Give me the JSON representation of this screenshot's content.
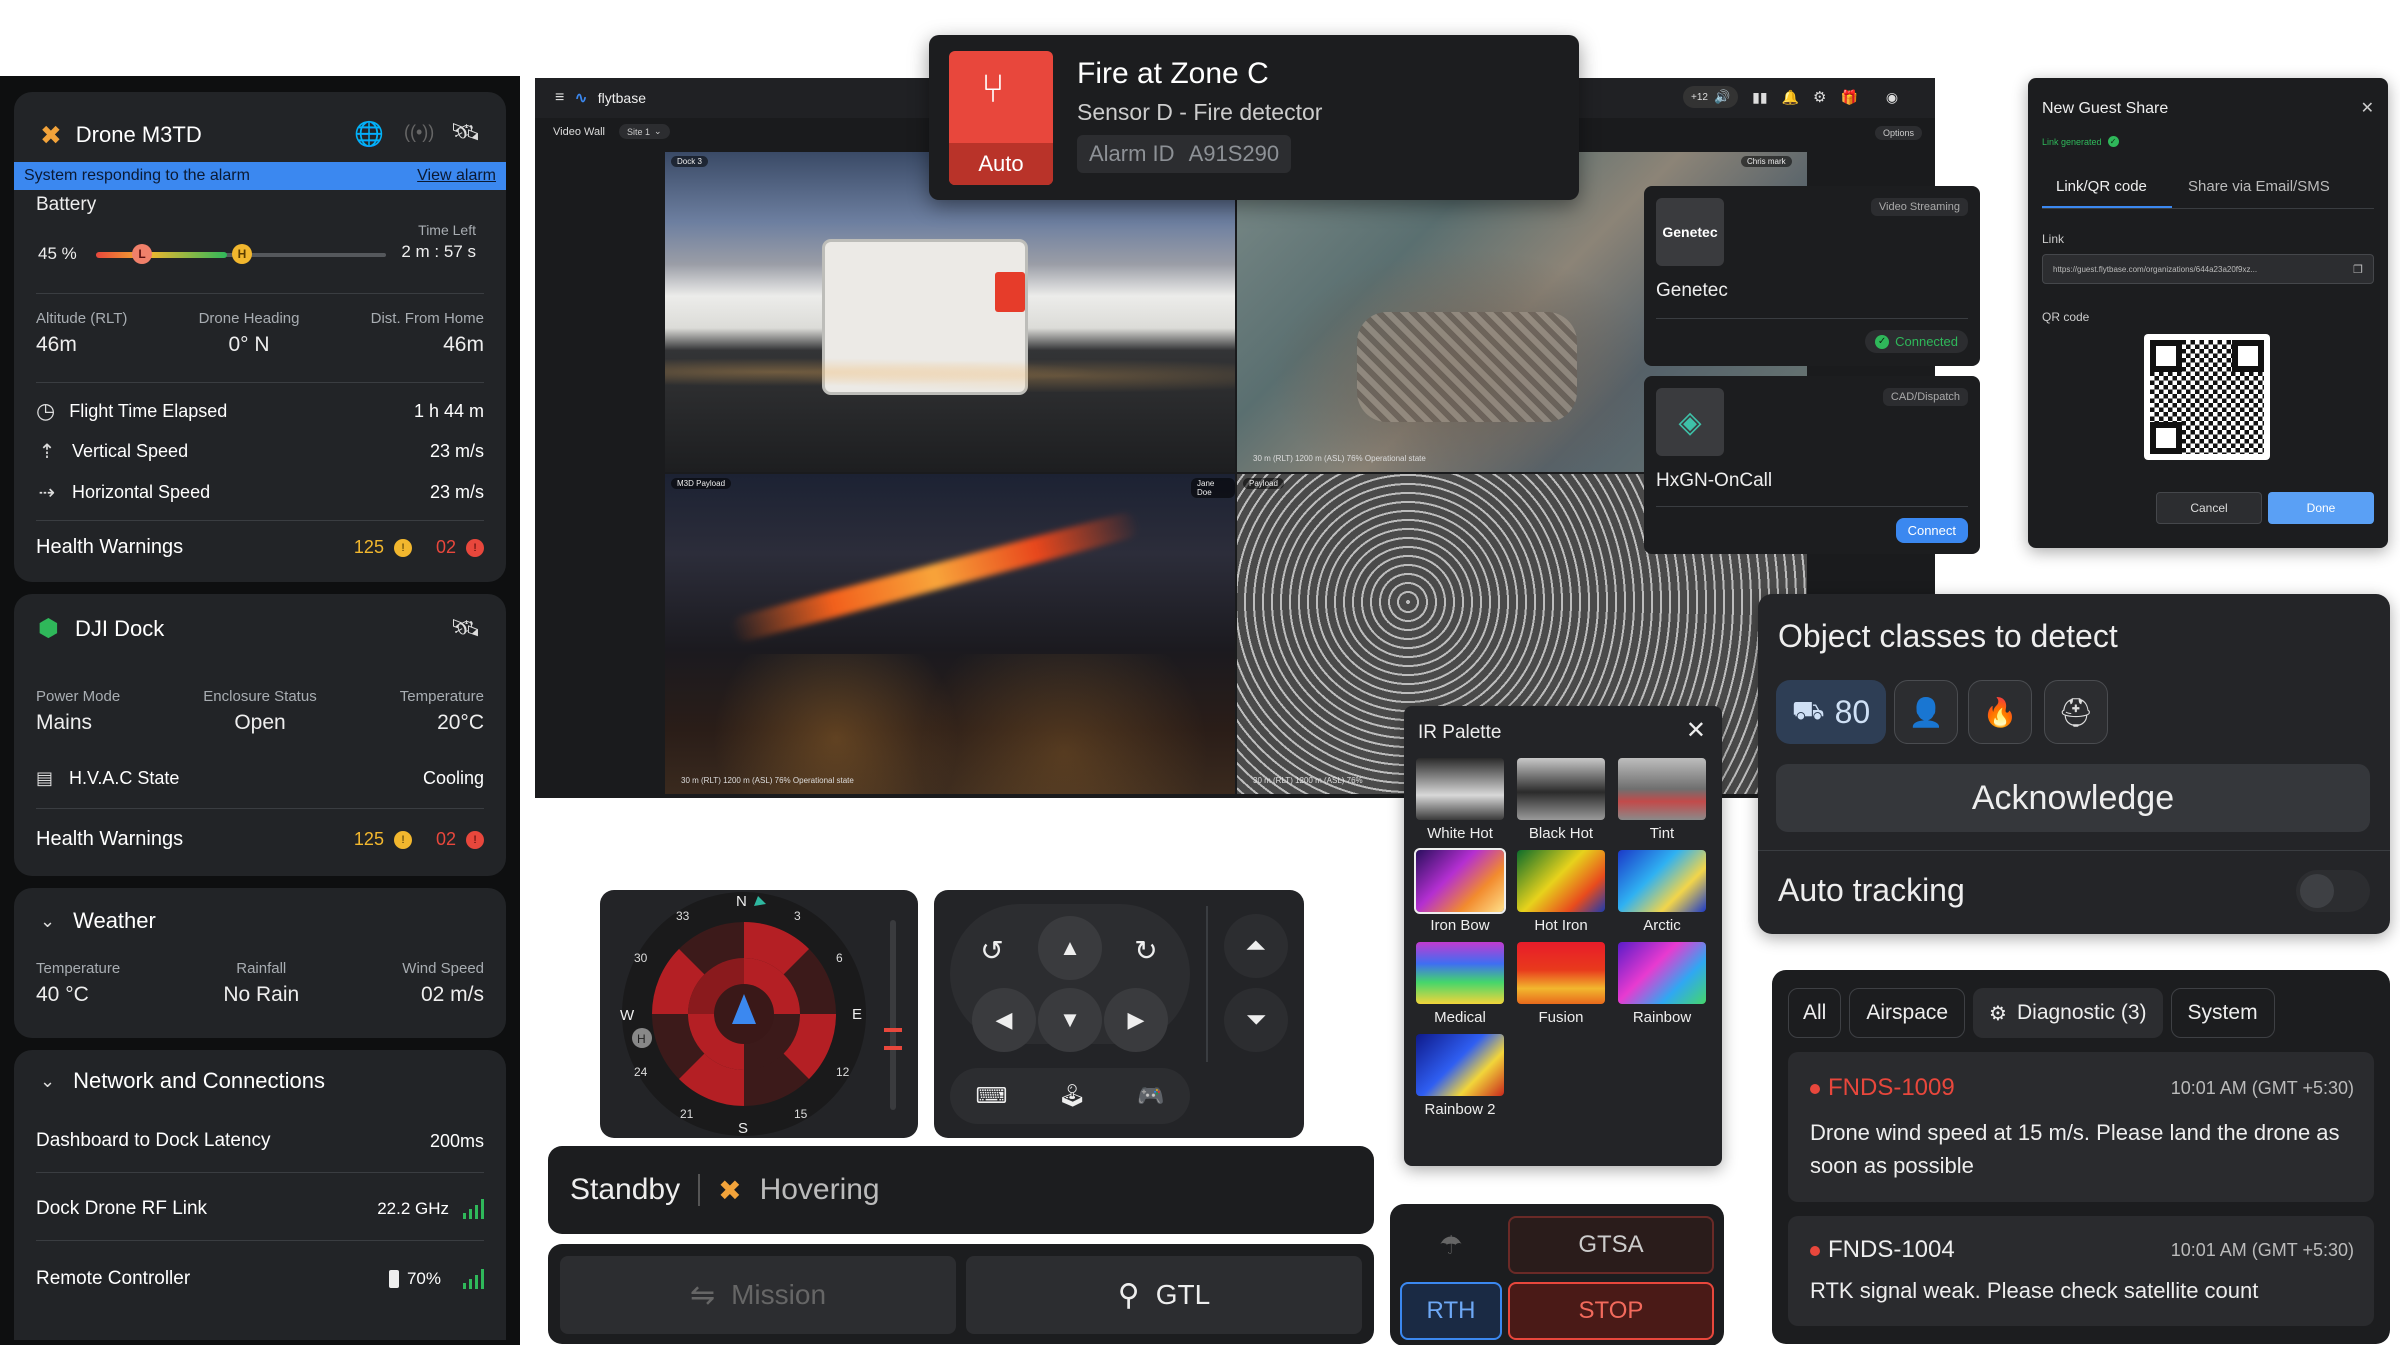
{
  "left_panel": {
    "drone": {
      "name": "Drone M3TD",
      "alert_text": "System responding to the alarm",
      "view_alarm": "View alarm",
      "battery_label": "Battery",
      "battery_percent": "45 %",
      "battery_level": 0.45,
      "time_left_label": "Time Left",
      "time_left": "2 m : 57 s",
      "marker_l": "L",
      "marker_h": "H",
      "stats": [
        {
          "label": "Altitude (RLT)",
          "value": "46m"
        },
        {
          "label": "Drone Heading",
          "value": "0° N"
        },
        {
          "label": "Dist. From Home",
          "value": "46m"
        }
      ],
      "rows": [
        {
          "label": "Flight Time Elapsed",
          "value": "1 h 44 m",
          "icon": "clock-icon"
        },
        {
          "label": "Vertical Speed",
          "value": "23 m/s",
          "icon": "vertical-speed-icon"
        },
        {
          "label": "Horizontal Speed",
          "value": "23 m/s",
          "icon": "horizontal-speed-icon"
        }
      ],
      "health_label": "Health Warnings",
      "warn_count": "125",
      "error_count": "02"
    },
    "dock": {
      "name": "DJI Dock",
      "stats": [
        {
          "label": "Power Mode",
          "value": "Mains"
        },
        {
          "label": "Enclosure Status",
          "value": "Open"
        },
        {
          "label": "Temperature",
          "value": "20°C"
        }
      ],
      "hvac_label": "H.V.A.C State",
      "hvac_value": "Cooling",
      "health_label": "Health Warnings",
      "warn_count": "125",
      "error_count": "02"
    },
    "weather": {
      "title": "Weather",
      "stats": [
        {
          "label": "Temperature",
          "value": "40 °C"
        },
        {
          "label": "Rainfall",
          "value": "No Rain"
        },
        {
          "label": "Wind Speed",
          "value": "02 m/s"
        }
      ]
    },
    "network": {
      "title": "Network and Connections",
      "rows": [
        {
          "label": "Dashboard to Dock Latency",
          "value": "200ms"
        },
        {
          "label": "Dock Drone RF Link",
          "value": "22.2 GHz"
        },
        {
          "label": "Remote Controller",
          "value": "70%"
        }
      ]
    }
  },
  "video_wall": {
    "brand": "flytbase",
    "tab": "Video Wall",
    "site": "Site 1",
    "options": "Options",
    "badge": "+12",
    "feeds": [
      {
        "tag": "Dock 3",
        "footer": ""
      },
      {
        "tag": "",
        "footer": "30 m (RLT)  1200 m (ASL)  76%  Operational state",
        "user": "Chris mark"
      },
      {
        "tag": "M3D Payload",
        "footer": "30 m (RLT)  1200 m (ASL)  76%  Operational state",
        "user": "Jane Doe"
      },
      {
        "tag": "Payload",
        "footer": "30 m (RLT)  1200 m (ASL)  76%"
      }
    ]
  },
  "alarm": {
    "title": "Fire at Zone C",
    "subtitle": "Sensor D - Fire detector",
    "mode": "Auto",
    "id_label": "Alarm ID",
    "id_value": "A91S290"
  },
  "integrations": [
    {
      "name": "Genetec",
      "logo_text": "Genetec",
      "category": "Video Streaming",
      "status": "Connected"
    },
    {
      "name": "HxGN-OnCall",
      "category": "CAD/Dispatch",
      "action": "Connect"
    }
  ],
  "guest_share": {
    "title": "New Guest Share",
    "link_generated": "Link generated",
    "tabs": [
      "Link/QR code",
      "Share via Email/SMS"
    ],
    "link_label": "Link",
    "link_value": "https://guest.flytbase.com/organizations/644a23a20f9xz...",
    "qr_label": "QR code",
    "cancel": "Cancel",
    "done": "Done"
  },
  "object_classes": {
    "title": "Object classes to detect",
    "vehicle_count": "80",
    "acknowledge": "Acknowledge",
    "auto_tracking": "Auto tracking",
    "auto_tracking_on": false
  },
  "ir_palette": {
    "title": "IR Palette",
    "items": [
      {
        "name": "White Hot",
        "bg": "linear-gradient(#2a2a2a,#d8d8d8 60%,#3a3a3a)"
      },
      {
        "name": "Black Hot",
        "bg": "linear-gradient(#c9c9c9,#2b2b2b 55%,#9a9a9a)"
      },
      {
        "name": "Tint",
        "bg": "linear-gradient(#bdbdbd,#6f6f6f 50%,#c24a4a 70%,#8a8a8a)"
      },
      {
        "name": "Iron Bow",
        "bg": "linear-gradient(135deg,#2a0f5e,#b42fd1 40%,#f28b2e 70%,#ffe08a)"
      },
      {
        "name": "Hot Iron",
        "bg": "linear-gradient(135deg,#0c6d2b,#e7d21c 45%,#e84b1d 75%,#1a3bb0)"
      },
      {
        "name": "Arctic",
        "bg": "linear-gradient(135deg,#1b39c8,#2fb1f2 40%,#f2d54a 70%,#1b39c8)"
      },
      {
        "name": "Medical",
        "bg": "linear-gradient(#c23bd0,#3f6ef2 35%,#45d66b 65%,#f2d53a)"
      },
      {
        "name": "Fusion",
        "bg": "linear-gradient(#e81c2a,#e83a1c 45%,#f2b72e 75%,#e86a1c)"
      },
      {
        "name": "Rainbow",
        "bg": "linear-gradient(135deg,#5a1cc8,#e83ad0 40%,#2fa8f2 70%,#45d66b)"
      },
      {
        "name": "Rainbow 2",
        "bg": "linear-gradient(135deg,#0e1a8a,#2f5ef2 45%,#f2d53a 70%,#c8281c)"
      }
    ]
  },
  "compass": {
    "n": "N",
    "e": "E",
    "s": "S",
    "w": "W",
    "ticks": [
      "3",
      "6",
      "12",
      "15",
      "21",
      "24",
      "30",
      "33"
    ],
    "home": "H"
  },
  "status_bar": {
    "state": "Standby",
    "flight": "Hovering"
  },
  "mission_bar": {
    "mission": "Mission",
    "gtl": "GTL"
  },
  "safety": {
    "gtsa": "GTSA",
    "rth": "RTH",
    "stop": "STOP"
  },
  "events": {
    "filters": [
      "All",
      "Airspace",
      "Diagnostic (3)",
      "System"
    ],
    "items": [
      {
        "code": "FNDS-1009",
        "time": "10:01 AM (GMT +5:30)",
        "message": "Drone wind speed at 15 m/s. Please land the drone as soon as possible",
        "color": "#e8473c"
      },
      {
        "code": "FNDS-1004",
        "time": "10:01 AM (GMT +5:30)",
        "message": "RTK signal weak. Please check satellite count",
        "color": "#e8473c"
      }
    ]
  },
  "colors": {
    "accent_blue": "#3a7cf0",
    "warn_yellow": "#f2b72e",
    "error_red": "#e8473c",
    "ok_green": "#2fb85a"
  }
}
